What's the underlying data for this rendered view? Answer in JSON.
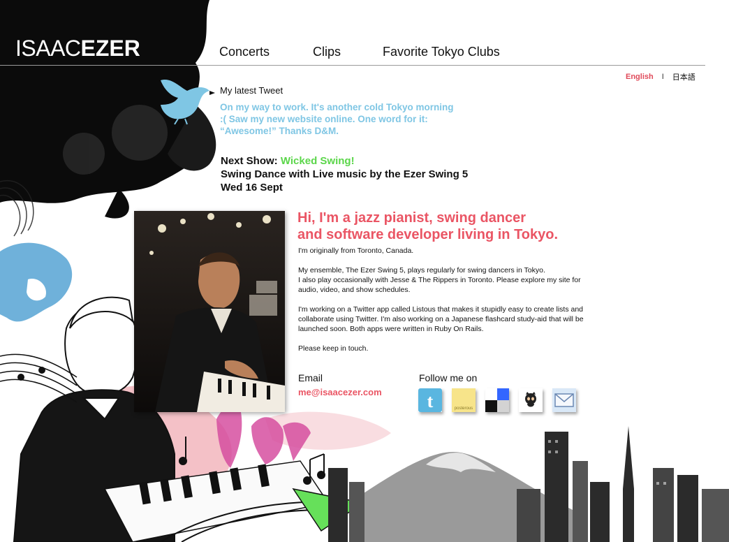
{
  "site": {
    "logo_light": "ISAAC",
    "logo_bold": "EZER"
  },
  "nav": {
    "items": [
      {
        "label": "Concerts"
      },
      {
        "label": "Clips"
      },
      {
        "label": "Favorite Tokyo Clubs"
      }
    ]
  },
  "language": {
    "english": "English",
    "separator": "I",
    "japanese": "日本語"
  },
  "tweet": {
    "title": "My latest Tweet",
    "text": "On my way to work. It's another cold Tokyo morning :( Saw my new website online. One word for it: “Awesome!” Thanks D&M."
  },
  "next_show": {
    "label": "Next Show:",
    "name": "Wicked Swing!",
    "description": "Swing Dance with Live music by the Ezer Swing 5",
    "date": "Wed 16 Sept"
  },
  "intro": {
    "headline_line1": "Hi, I'm a jazz pianist, swing dancer",
    "headline_line2": "and software developer living in Tokyo.",
    "p1": "I'm originally from Toronto, Canada.",
    "p2a": "My ensemble, The Ezer Swing 5, plays regularly for swing dancers in Tokyo.",
    "p2b": "I also play occasionally with Jesse & The Rippers in Toronto. Please explore my site for audio, video, and show schedules.",
    "p3": "I'm working on a Twitter app called Listous that makes it stupidly easy to create lists and collaborate using Twitter. I'm also working on a Japanese flashcard study-aid that will be launched soon. Both apps were written in Ruby On Rails.",
    "p4": "Please keep in touch."
  },
  "contact": {
    "email_label": "Email",
    "email": "me@isaacezer.com",
    "follow_label": "Follow me on",
    "posterous_text": "posterous"
  },
  "colors": {
    "accent_red": "#ea5564",
    "tweet_blue": "#7fc6e4",
    "show_green": "#5bd64a"
  }
}
